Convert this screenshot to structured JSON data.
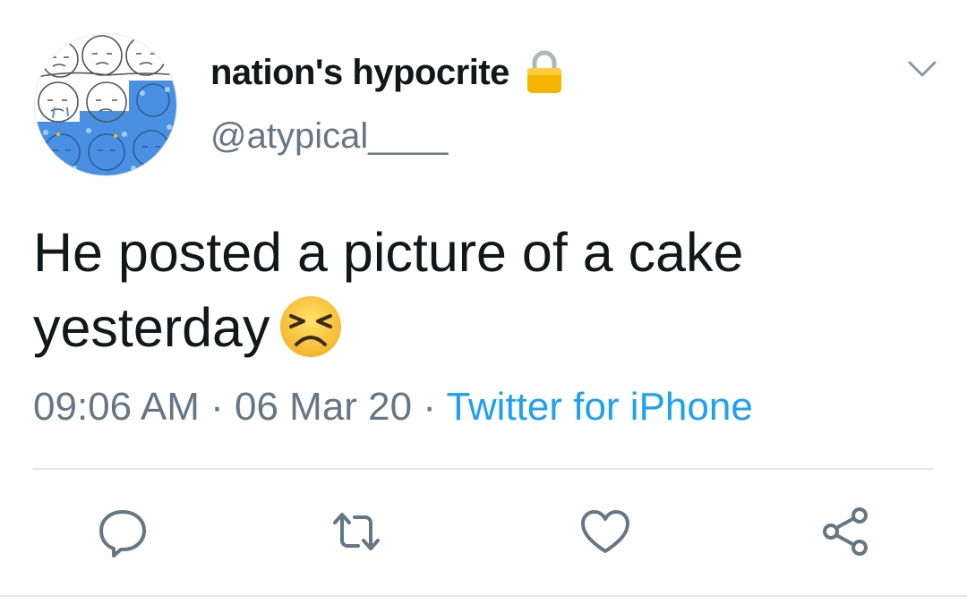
{
  "author": {
    "display_name": "nation's hypocrite",
    "handle": "@atypical____",
    "protected_icon": "lock-icon",
    "avatar_icon": "avatar-drawing"
  },
  "tweet": {
    "text": "He posted a picture of a cake yesterday",
    "emoji": "persevering-face-emoji"
  },
  "meta": {
    "time": "09:06 AM",
    "separator1": " · ",
    "date": "06 Mar 20",
    "separator2": " · ",
    "source": "Twitter for iPhone"
  },
  "actions": [
    "reply-icon",
    "retweet-icon",
    "like-icon",
    "share-icon"
  ],
  "colors": {
    "text": "#14171a",
    "secondary": "#657786",
    "link": "#1da1f2",
    "divider": "#e1e8ed",
    "icon": "#657786"
  }
}
